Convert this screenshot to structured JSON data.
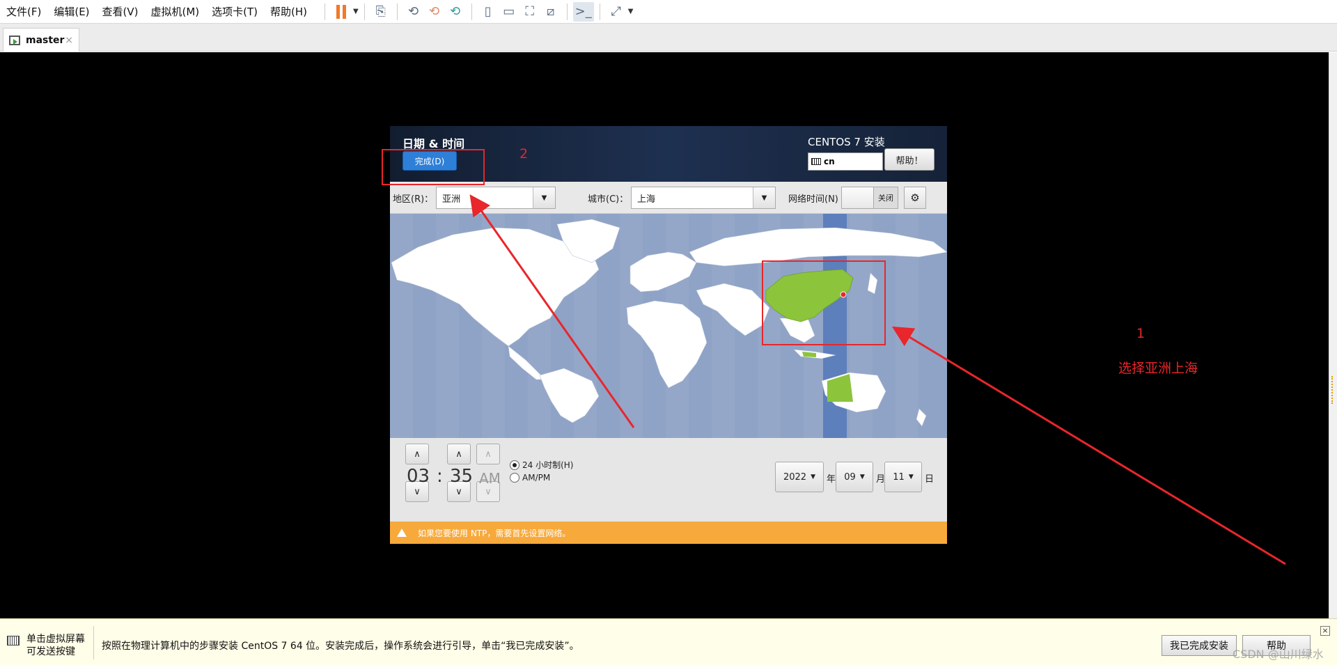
{
  "menu": [
    "文件(F)",
    "编辑(E)",
    "查看(V)",
    "虚拟机(M)",
    "选项卡(T)",
    "帮助(H)"
  ],
  "tab": {
    "label": "master",
    "close": "×"
  },
  "installer": {
    "title": "日期 & 时间",
    "done_button": "完成(D)",
    "product": "CENTOS 7 安装",
    "keyboard_layout": "cn",
    "help_button": "帮助！",
    "region_label": "地区(R)：",
    "region_value": "亚洲",
    "city_label": "城市(C)：",
    "city_value": "上海",
    "network_time_label": "网络时间(N)",
    "network_time_state": "关闭",
    "hour": "03",
    "colon": ":",
    "minute": "35",
    "ampm": "AM",
    "format_24h": "24 小时制(H)",
    "format_ampm": "AM/PM",
    "year": "2022",
    "year_unit": "年",
    "month": "09",
    "month_unit": "月",
    "day": "11",
    "day_unit": "日",
    "warning": "如果您要使用 NTP，需要首先设置网络。"
  },
  "annotations": {
    "step1_number": "1",
    "step1_text": "选择亚洲上海",
    "step2_number": "2"
  },
  "statusbar": {
    "hint_line1": "单击虚拟屏幕",
    "hint_line2": "可发送按键",
    "message": "按照在物理计算机中的步骤安装 CentOS 7 64 位。安装完成后，操作系统会进行引导，单击“我已完成安装”。",
    "finished_button": "我已完成安装",
    "help_button": "帮助",
    "close": "×"
  },
  "watermark": "CSDN @山川绿水",
  "colors": {
    "annotation_red": "#e8262b",
    "done_blue": "#2d7fd8",
    "warning_orange": "#f7a93b",
    "map_ocean": "#8fa3c6",
    "selected_region_green": "#8cc43c"
  }
}
